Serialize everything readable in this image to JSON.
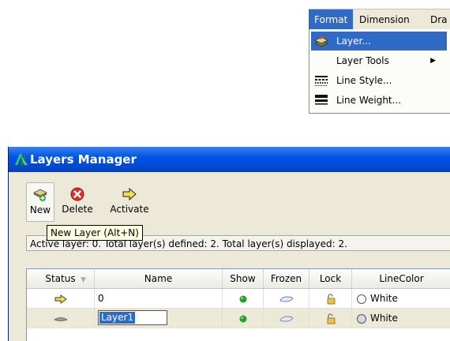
{
  "menubar": {
    "items": [
      "Format",
      "Dimension",
      "Dra"
    ]
  },
  "format_menu": {
    "items": [
      {
        "label": "Layer...",
        "icon": "layer-icon",
        "submenu": false
      },
      {
        "label": "Layer Tools",
        "icon": "",
        "submenu": true
      },
      {
        "label": "Line Style...",
        "icon": "line-style-icon",
        "submenu": false
      },
      {
        "label": "Line Weight...",
        "icon": "line-weight-icon",
        "submenu": false
      }
    ]
  },
  "dialog": {
    "title": "Layers Manager",
    "toolbar": {
      "new_label": "New",
      "delete_label": "Delete",
      "activate_label": "Activate"
    },
    "tooltip": "New Layer (Alt+N)",
    "status": "Active layer: 0. Total layer(s) defined: 2. Total layer(s) displayed: 2.",
    "columns": [
      "Status",
      "Name",
      "Show",
      "Frozen",
      "Lock",
      "LineColor"
    ],
    "rows": [
      {
        "status": "active-arrow-icon",
        "name": "0",
        "show": "on",
        "frozen": "no",
        "lock": "unlocked",
        "color_name": "White",
        "color": "#ffffff"
      },
      {
        "status": "layer-icon",
        "name": "Layer1",
        "show": "on",
        "frozen": "no",
        "lock": "unlocked",
        "color_name": "White",
        "color": "#ffffff"
      }
    ]
  },
  "colors": {
    "menu_highlight": "#316ac5",
    "title_bar": "#0055e5",
    "dialog_bg": "#ece9d8",
    "tooltip_bg": "#ffffe1",
    "show_dot": "#22a02a"
  }
}
